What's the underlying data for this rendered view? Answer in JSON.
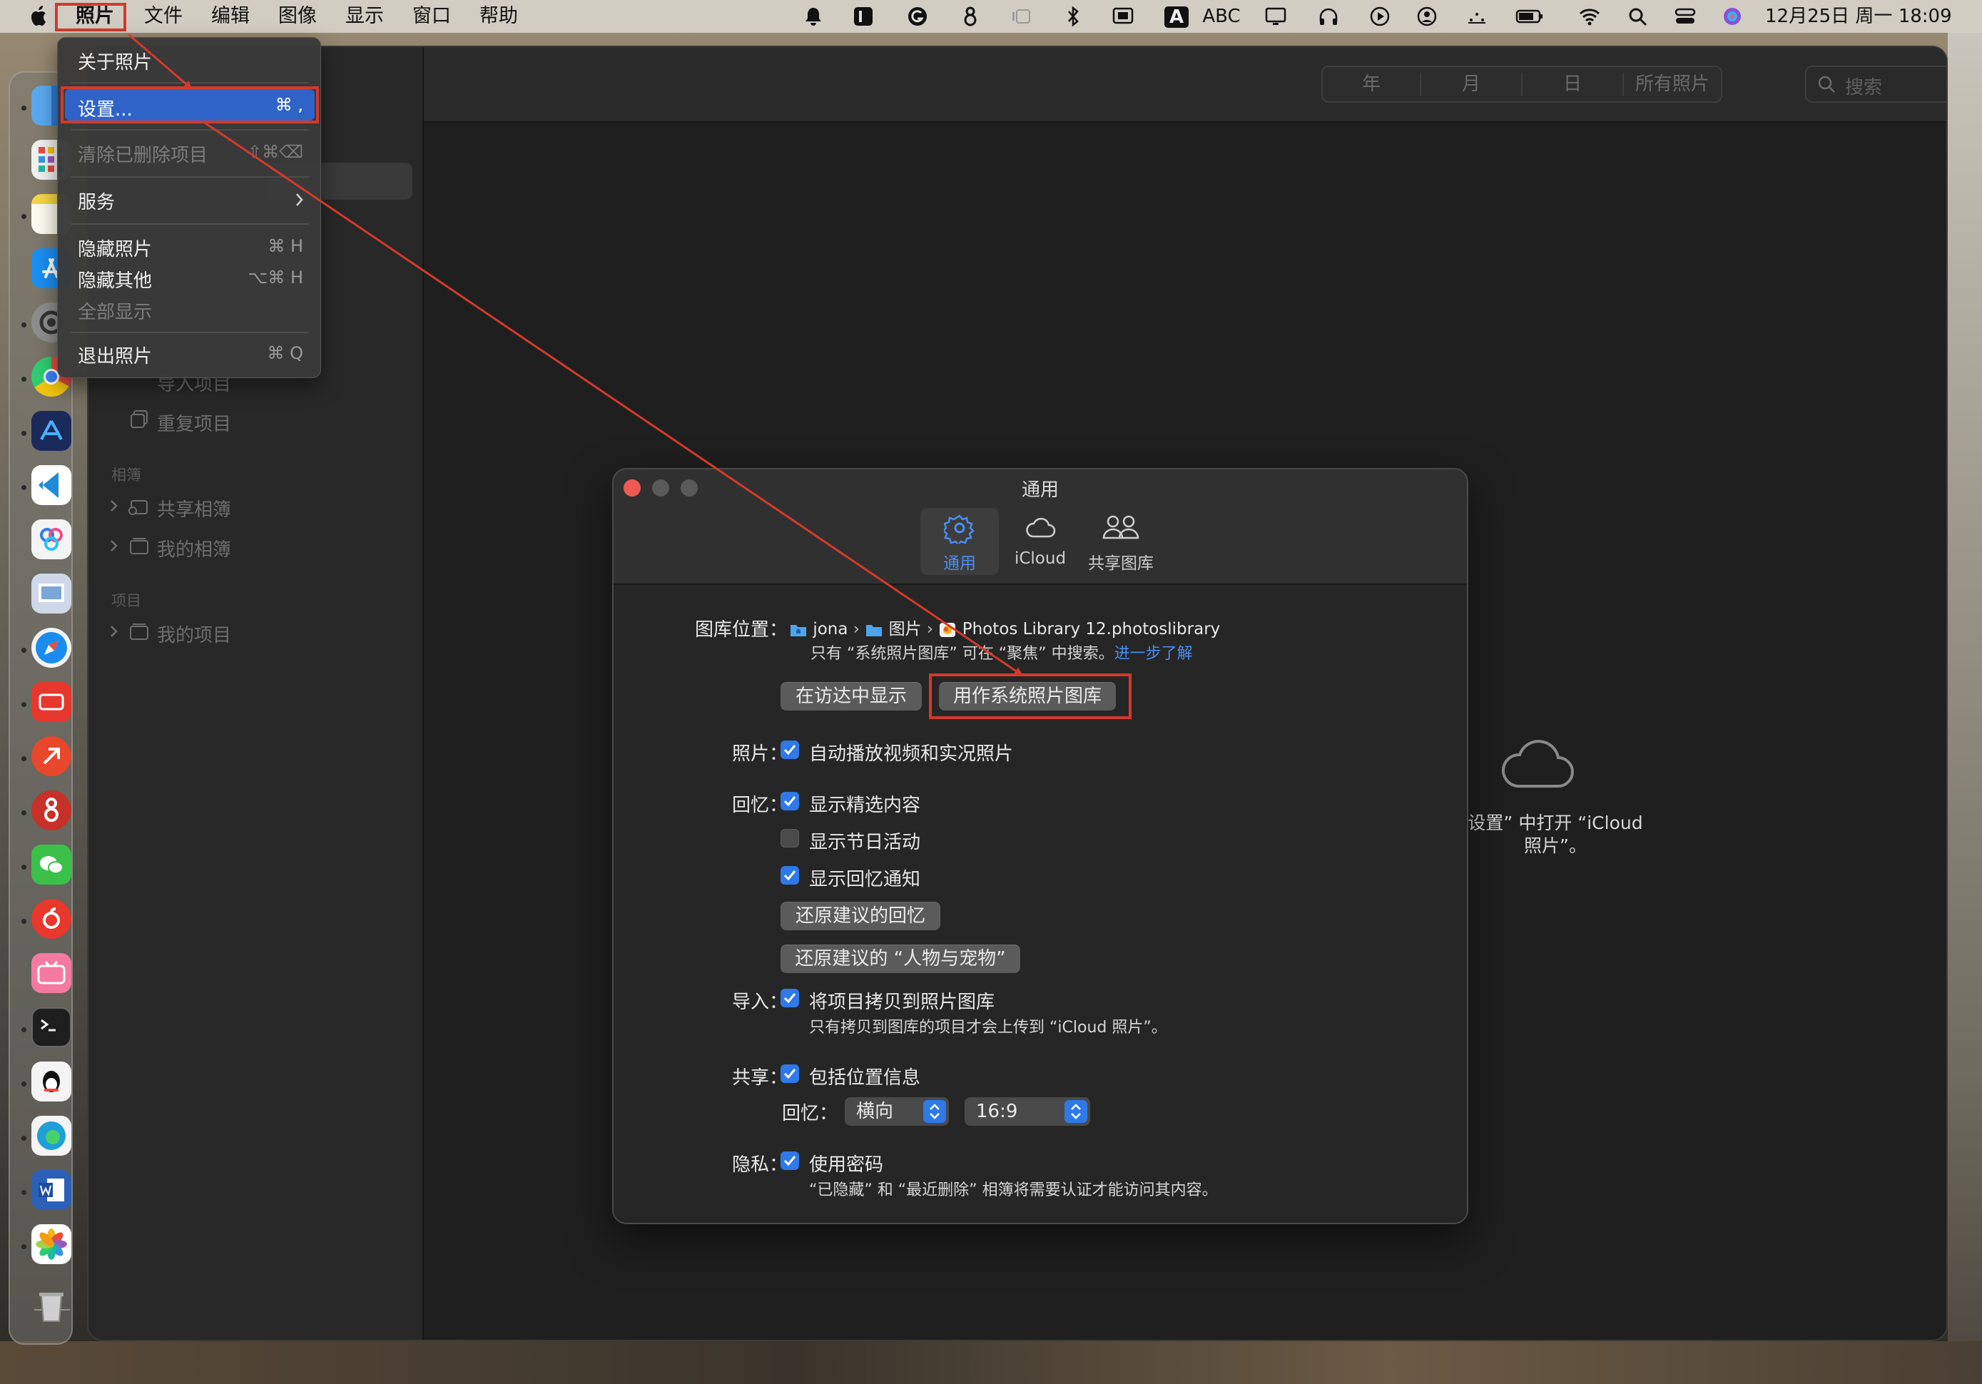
{
  "menubar": {
    "app_menu": "照片",
    "items": [
      "文件",
      "编辑",
      "图像",
      "显示",
      "窗口",
      "帮助"
    ],
    "status_abc": "ABC",
    "status_a": "A",
    "datetime": "12月25日 周一  18:09"
  },
  "dropdown": {
    "about": "关于照片",
    "settings": "设置...",
    "settings_shortcut": "⌘ ,",
    "clear_deleted": "清除已删除项目",
    "clear_deleted_shortcut": "⇧⌘⌫",
    "services": "服务",
    "hide_photos": "隐藏照片",
    "hide_photos_shortcut": "⌘ H",
    "hide_others": "隐藏其他",
    "hide_others_shortcut": "⌥⌘ H",
    "show_all": "全部显示",
    "quit": "退出照片",
    "quit_shortcut": "⌘ Q"
  },
  "toolbar": {
    "segments": [
      "年",
      "月",
      "日",
      "所有照片"
    ],
    "search_placeholder": "搜索"
  },
  "sidebar": {
    "partial_item": "导入项目",
    "duplicates": "重复项目",
    "albums_header": "相簿",
    "shared_albums": "共享相簿",
    "my_albums": "我的相簿",
    "projects_header": "项目",
    "my_projects": "我的项目"
  },
  "main": {
    "empty_line1": "设置” 中打开 “iCloud",
    "empty_line2": "照片”。"
  },
  "dialog": {
    "title": "通用",
    "tabs": [
      {
        "label": "通用",
        "icon": "gear-icon",
        "active": true
      },
      {
        "label": "iCloud",
        "icon": "cloud-icon",
        "active": false
      },
      {
        "label": "共享图库",
        "icon": "people-icon",
        "active": false
      }
    ],
    "library_location_label": "图库位置：",
    "path": {
      "user": "jona",
      "folder": "图片",
      "library": "Photos Library 12.photoslibrary"
    },
    "library_note": "只有 “系统照片图库” 可在 “聚焦” 中搜索。",
    "learn_more": "进一步了解",
    "show_in_finder": "在访达中显示",
    "use_as_system_library": "用作系统照片图库",
    "photos_label": "照片：",
    "autoplay": "自动播放视频和实况照片",
    "memories_label": "回忆：",
    "show_featured": "显示精选内容",
    "show_holidays": "显示节日活动",
    "show_memory_notifications": "显示回忆通知",
    "reset_suggested_memories": "还原建议的回忆",
    "reset_people_pets": "还原建议的 “人物与宠物”",
    "import_label": "导入：",
    "copy_items": "将项目拷贝到照片图库",
    "copy_items_note": "只有拷贝到图库的项目才会上传到 “iCloud 照片”。",
    "sharing_label": "共享：",
    "include_location": "包括位置信息",
    "memories_sub_label": "回忆：",
    "orientation_value": "横向",
    "ratio_value": "16:9",
    "privacy_label": "隐私：",
    "use_password": "使用密码",
    "password_note": "“已隐藏” 和 “最近删除” 相簿将需要认证才能访问其内容。",
    "checkboxes": {
      "autoplay": true,
      "show_featured": true,
      "show_holidays": false,
      "show_memory_notifications": true,
      "copy_items": true,
      "include_location": true,
      "use_password": true
    }
  },
  "colors": {
    "accent": "#2f79e8",
    "annotation": "#d33a2c",
    "menu_selection": "#2f63c7"
  }
}
